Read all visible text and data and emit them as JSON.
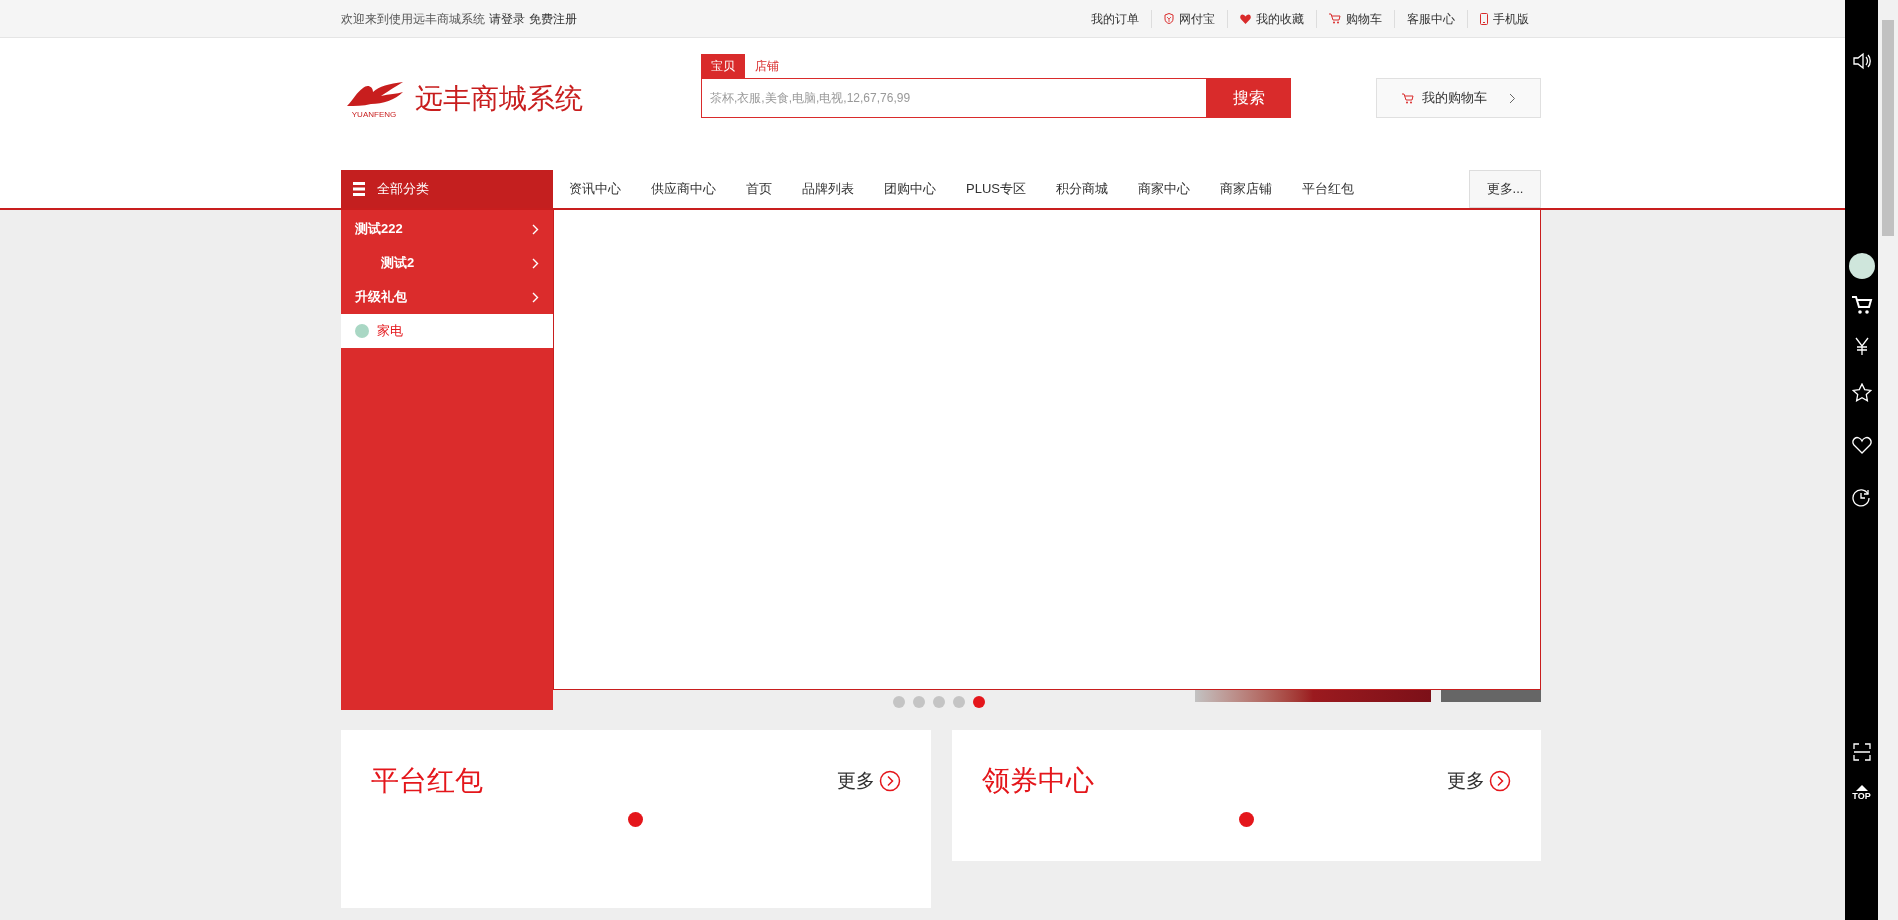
{
  "top_bar": {
    "welcome": "欢迎来到使用远丰商城系统",
    "login": "请登录",
    "register": "免费注册",
    "links": [
      {
        "label": "我的订单",
        "kind": "plain"
      },
      {
        "label": "网付宝",
        "kind": "shield"
      },
      {
        "label": "我的收藏",
        "kind": "heart"
      },
      {
        "label": "购物车",
        "kind": "cart"
      },
      {
        "label": "客服中心",
        "kind": "plain"
      },
      {
        "label": "手机版",
        "kind": "phone"
      }
    ]
  },
  "header": {
    "logo_text": "远丰商城系统",
    "logo_subtext": "YUANFENG",
    "search_tabs": [
      {
        "label": "宝贝",
        "selected": true
      },
      {
        "label": "店铺",
        "selected": false
      }
    ],
    "search": {
      "placeholder": "茶杯,衣服,美食,电脑,电视,12,67,76,99",
      "button": "搜索"
    },
    "cart_button": "我的购物车"
  },
  "nav": {
    "category_title": "全部分类",
    "items": [
      "资讯中心",
      "供应商中心",
      "首页",
      "品牌列表",
      "团购中心",
      "PLUS专区",
      "积分商城",
      "商家中心",
      "商家店铺",
      "平台红包"
    ],
    "more": "更多..."
  },
  "categories": [
    {
      "label": "测试222",
      "selected": false,
      "children": [
        {
          "label": "测试2",
          "selected": false
        }
      ]
    },
    {
      "label": "升级礼包",
      "selected": false
    },
    {
      "label": "家电",
      "selected": true
    }
  ],
  "carousel_dots": [
    {
      "selected": false
    },
    {
      "selected": false
    },
    {
      "selected": false
    },
    {
      "selected": false
    },
    {
      "selected": true
    }
  ],
  "cards": [
    {
      "title": "平台红包",
      "more": "更多"
    },
    {
      "title": "领券中心",
      "more": "更多"
    }
  ],
  "side_toolbar": {
    "top_label": "TOP"
  }
}
